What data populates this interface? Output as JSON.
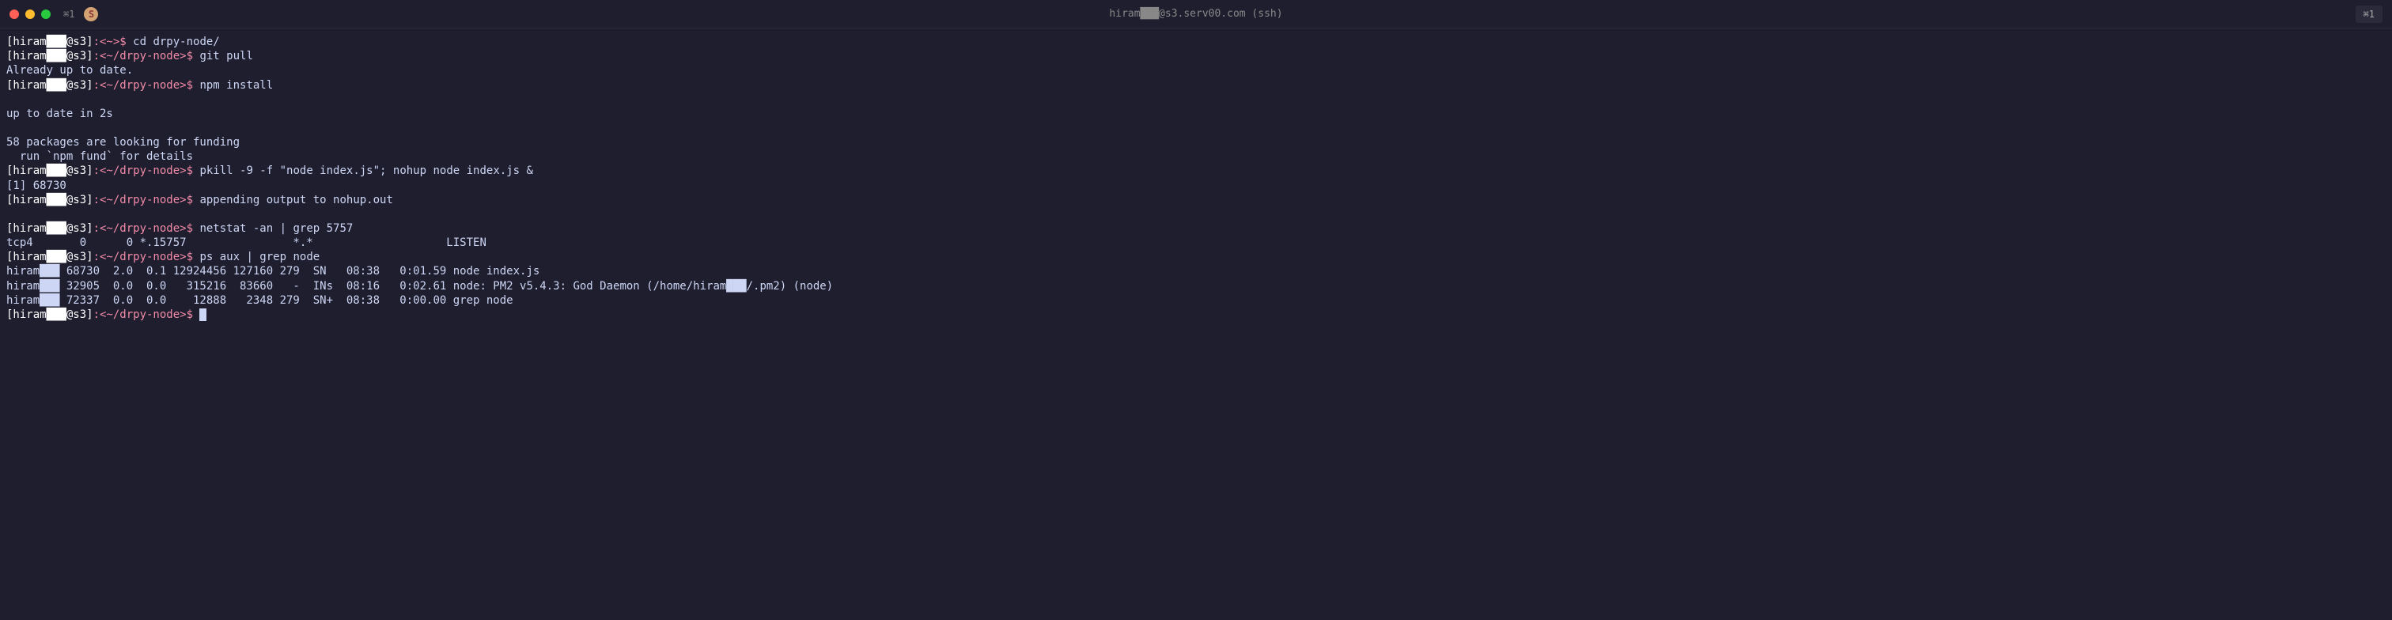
{
  "titlebar": {
    "tab_shortcut": "⌘1",
    "s_icon": "S",
    "title": "hiram███@s3.serv00.com (ssh)",
    "right_shortcut": "⌘1"
  },
  "terminal": {
    "lines": [
      {
        "type": "prompt",
        "user": "[hiram███@s3]",
        "path": ":<~>",
        "dollar": "$ ",
        "cmd": "cd drpy-node/"
      },
      {
        "type": "prompt",
        "user": "[hiram███@s3]",
        "path": ":<~/drpy-node>",
        "dollar": "$ ",
        "cmd": "git pull"
      },
      {
        "type": "output",
        "text": "Already up to date."
      },
      {
        "type": "prompt",
        "user": "[hiram███@s3]",
        "path": ":<~/drpy-node>",
        "dollar": "$ ",
        "cmd": "npm install"
      },
      {
        "type": "output",
        "text": ""
      },
      {
        "type": "output",
        "text": "up to date in 2s"
      },
      {
        "type": "output",
        "text": ""
      },
      {
        "type": "output",
        "text": "58 packages are looking for funding"
      },
      {
        "type": "output",
        "text": "  run `npm fund` for details"
      },
      {
        "type": "prompt",
        "user": "[hiram███@s3]",
        "path": ":<~/drpy-node>",
        "dollar": "$ ",
        "cmd": "pkill -9 -f \"node index.js\"; nohup node index.js &"
      },
      {
        "type": "output",
        "text": "[1] 68730"
      },
      {
        "type": "prompt",
        "user": "[hiram███@s3]",
        "path": ":<~/drpy-node>",
        "dollar": "$ ",
        "cmd": "appending output to nohup.out"
      },
      {
        "type": "output",
        "text": ""
      },
      {
        "type": "prompt",
        "user": "[hiram███@s3]",
        "path": ":<~/drpy-node>",
        "dollar": "$ ",
        "cmd": "netstat -an | grep 5757"
      },
      {
        "type": "output",
        "text": "tcp4       0      0 *.15757                *.*                    LISTEN"
      },
      {
        "type": "prompt",
        "user": "[hiram███@s3]",
        "path": ":<~/drpy-node>",
        "dollar": "$ ",
        "cmd": "ps aux | grep node"
      },
      {
        "type": "output",
        "text": "hiram███ 68730  2.0  0.1 12924456 127160 279  SN   08:38   0:01.59 node index.js"
      },
      {
        "type": "output",
        "text": "hiram███ 32905  0.0  0.0   315216  83660   -  INs  08:16   0:02.61 node: PM2 v5.4.3: God Daemon (/home/hiram███/.pm2) (node)"
      },
      {
        "type": "output",
        "text": "hiram███ 72337  0.0  0.0    12888   2348 279  SN+  08:38   0:00.00 grep node"
      },
      {
        "type": "prompt_cursor",
        "user": "[hiram███@s3]",
        "path": ":<~/drpy-node>",
        "dollar": "$ ",
        "cmd": ""
      }
    ]
  }
}
